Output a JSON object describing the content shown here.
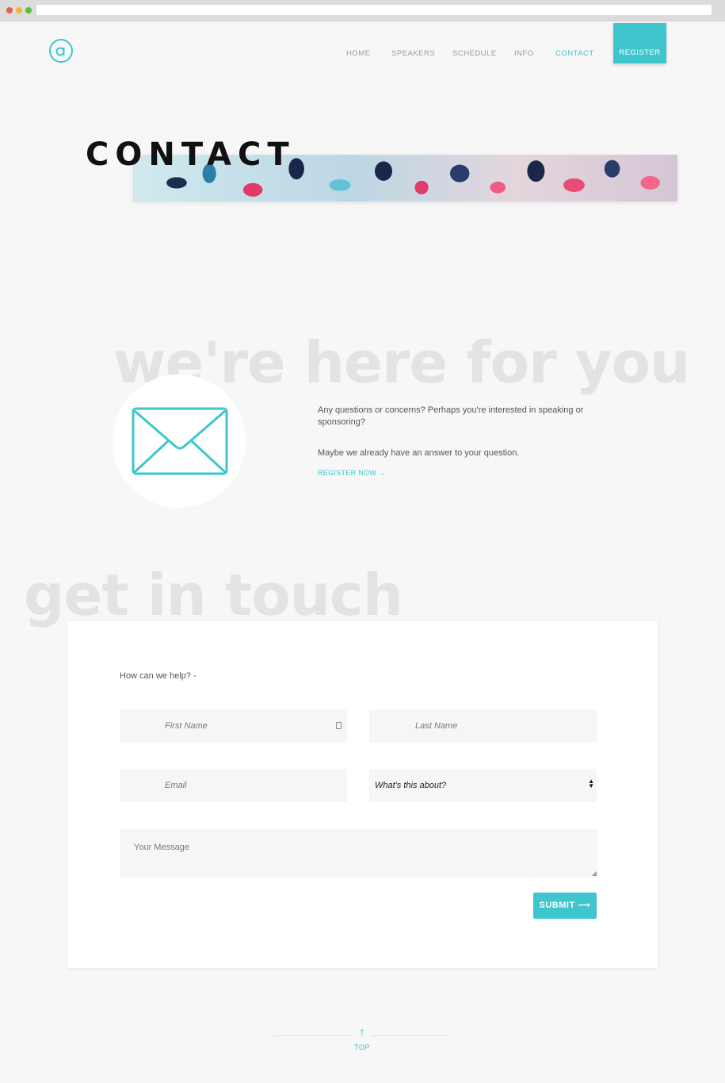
{
  "nav": {
    "items": [
      {
        "label": "HOME"
      },
      {
        "label": "SPEAKERS"
      },
      {
        "label": "SCHEDULE"
      },
      {
        "label": "INFO"
      },
      {
        "label": "CONTACT",
        "active": true
      }
    ],
    "register_label": "REGISTER"
  },
  "hero": {
    "title": "CONTACT"
  },
  "intro": {
    "watermark": "we're here for you",
    "question": "Any questions or concerns? Perhaps you're interested in speaking or sponsoring?",
    "answer": "Maybe we already have an answer to your question.",
    "register_link": "REGISTER NOW →"
  },
  "form": {
    "watermark": "get in touch",
    "heading": "How can we help? -",
    "first_name_placeholder": "First Name",
    "last_name_placeholder": "Last Name",
    "email_placeholder": "Email",
    "topic_selected": "What's this about?",
    "message_placeholder": "Your Message",
    "submit_label": "SUBMIT ⟶"
  },
  "footer": {
    "top_label": "TOP",
    "top_arrow": "↑"
  },
  "colors": {
    "accent": "#3ec6cc",
    "background": "#f7f7f7",
    "watermark": "#e3e3e3"
  }
}
